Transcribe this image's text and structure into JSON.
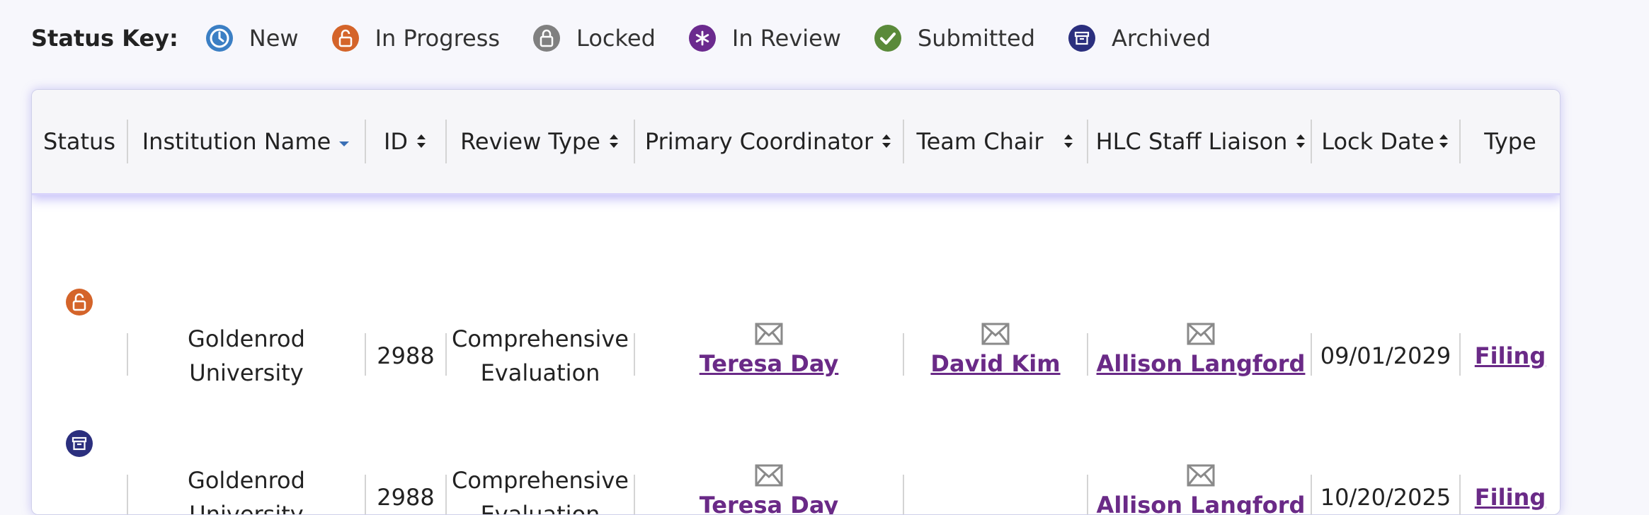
{
  "status_key": {
    "label": "Status Key:",
    "items": [
      {
        "name": "New",
        "icon": "clock-icon",
        "color": "#3b7fc4"
      },
      {
        "name": "In Progress",
        "icon": "unlock-icon",
        "color": "#d4642a"
      },
      {
        "name": "Locked",
        "icon": "lock-icon",
        "color": "#808080"
      },
      {
        "name": "In Review",
        "icon": "asterisk-icon",
        "color": "#6b2a8e"
      },
      {
        "name": "Submitted",
        "icon": "check-icon",
        "color": "#5a8a3a"
      },
      {
        "name": "Archived",
        "icon": "archive-icon",
        "color": "#2b2f7e"
      }
    ]
  },
  "table": {
    "columns": [
      "Status",
      "Institution Name",
      "ID",
      "Review Type",
      "Primary Coordinator",
      "Team Chair",
      "HLC Staff Liaison",
      "Lock Date",
      "Type"
    ],
    "rows": [
      {
        "status": "In Progress",
        "institution": [
          "Goldenrod",
          "University"
        ],
        "id": "2988",
        "review_type": [
          "Comprehensive",
          "Evaluation"
        ],
        "primary_coordinator": "Teresa Day",
        "team_chair": "David Kim",
        "hlc_staff_liaison": "Allison Langford",
        "lock_date": "09/01/2029",
        "type": "Filing"
      },
      {
        "status": "Archived",
        "institution": [
          "Goldenrod",
          "University"
        ],
        "id": "2988",
        "review_type": [
          "Comprehensive",
          "Evaluation"
        ],
        "primary_coordinator": "Teresa Day",
        "team_chair": "",
        "hlc_staff_liaison": "Allison Langford",
        "lock_date": "10/20/2025",
        "type": "Filing"
      }
    ]
  }
}
